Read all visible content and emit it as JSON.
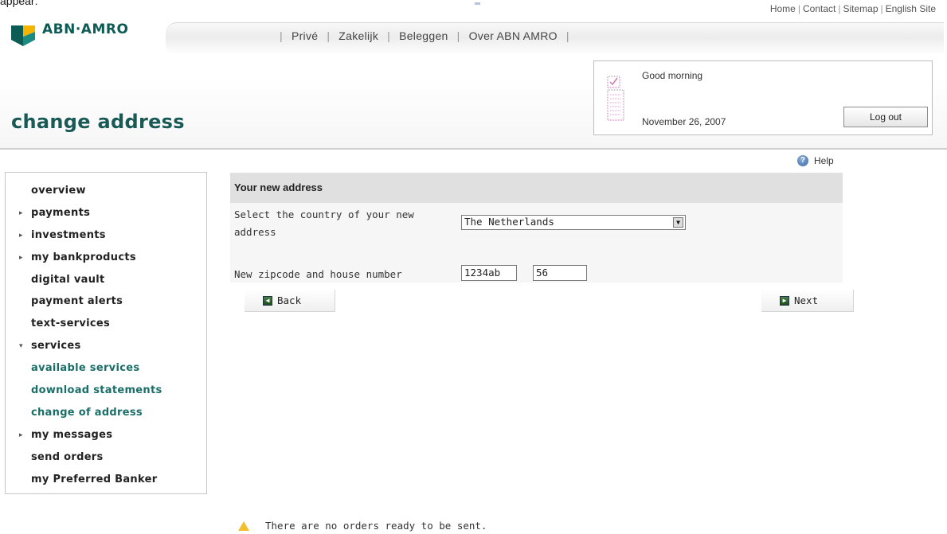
{
  "top_cut_text": "appear:",
  "utility_links": [
    "Home",
    "Contact",
    "Sitemap",
    "English Site"
  ],
  "brand": {
    "name": "ABN·AMRO",
    "colors": {
      "green": "#0d5b55",
      "yellow": "#f4b400"
    }
  },
  "main_nav": [
    "Privé",
    "Zakelijk",
    "Beleggen",
    "Over ABN AMRO"
  ],
  "page_title": "change address",
  "greeting": {
    "text": "Good morning",
    "date": "November 26, 2007",
    "logout_label": "Log out",
    "icon": "calendar-icon"
  },
  "help_label": "Help",
  "sidebar": {
    "items": [
      {
        "label": "overview",
        "arrow": ""
      },
      {
        "label": "payments",
        "arrow": "▸"
      },
      {
        "label": "investments",
        "arrow": "▸"
      },
      {
        "label": "my bankproducts",
        "arrow": "▸"
      },
      {
        "label": "digital vault",
        "arrow": ""
      },
      {
        "label": "payment alerts",
        "arrow": ""
      },
      {
        "label": "text-services",
        "arrow": ""
      },
      {
        "label": "services",
        "arrow": "▾"
      },
      {
        "label": "available services",
        "arrow": ""
      },
      {
        "label": "download statements",
        "arrow": ""
      },
      {
        "label": "change of address",
        "arrow": ""
      },
      {
        "label": "my messages",
        "arrow": "▸"
      },
      {
        "label": "send orders",
        "arrow": ""
      },
      {
        "label": "my Preferred Banker",
        "arrow": ""
      }
    ]
  },
  "form": {
    "header": "Your new address",
    "country_label_line1": "Select the country of your new",
    "country_label_line2": "address",
    "country_value": "The Netherlands",
    "zip_label": "New zipcode and house number",
    "zip_value": "1234ab",
    "house_value": "56",
    "back_label": "Back",
    "next_label": "Next"
  },
  "notice": "There are no orders ready to be sent."
}
